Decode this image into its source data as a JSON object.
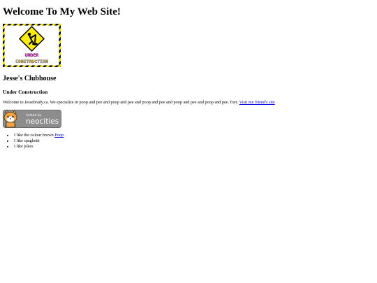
{
  "page": {
    "title": "Welcome To My Web Site!"
  },
  "construction_image": {
    "line1": "UNDER",
    "line2": "CONSTRUCTION",
    "icon": "digging-worker-sign-icon",
    "colors": {
      "border_yellow": "#f5e200",
      "border_black": "#000000",
      "sign_yellow": "#ffee00"
    }
  },
  "section": {
    "heading": "Jesse's Clubhouse",
    "subheading": "Under Construction"
  },
  "intro": {
    "text": "Welcome to Jessebrady.ca. We specialize in poop and pee and poop and pee and poop and pee and poop and pee and poop and pee. Fart.",
    "link_label": "Visit my friend's site"
  },
  "badge": {
    "line1": "hosted by",
    "line2": "neocities",
    "icon": "neocities-cat-icon"
  },
  "likes": [
    {
      "text": "I like the colour brown",
      "link": "Poop"
    },
    {
      "text": "I like spaghetti"
    },
    {
      "text": "I like jokes"
    }
  ]
}
